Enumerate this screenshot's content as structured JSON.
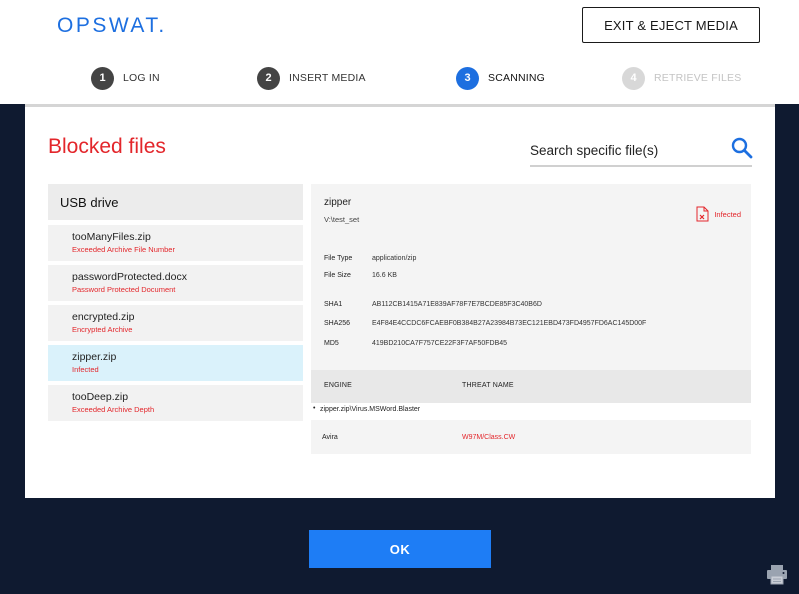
{
  "header": {
    "logo_text": "OPSWAT.",
    "exit_label": "EXIT & EJECT MEDIA"
  },
  "steps": [
    {
      "num": "1",
      "label": "LOG IN",
      "state": "done"
    },
    {
      "num": "2",
      "label": "INSERT MEDIA",
      "state": "done"
    },
    {
      "num": "3",
      "label": "SCANNING",
      "state": "active"
    },
    {
      "num": "4",
      "label": "RETRIEVE FILES",
      "state": "disabled"
    }
  ],
  "main": {
    "title": "Blocked files",
    "search_placeholder": "Search specific file(s)",
    "drive_label": "USB drive",
    "files": [
      {
        "name": "tooManyFiles.zip",
        "status": "Exceeded Archive File Number"
      },
      {
        "name": "passwordProtected.docx",
        "status": "Password Protected Document"
      },
      {
        "name": "encrypted.zip",
        "status": "Encrypted Archive"
      },
      {
        "name": "zipper.zip",
        "status": "Infected"
      },
      {
        "name": "tooDeep.zip",
        "status": "Exceeded Archive Depth"
      }
    ]
  },
  "detail": {
    "name": "zipper",
    "path": "V:\\test_set",
    "status_label": "Infected",
    "file_type_label": "File Type",
    "file_type": "application/zip",
    "file_size_label": "File Size",
    "file_size": "16.6 KB",
    "sha1_label": "SHA1",
    "sha1": "AB112CB1415A71E839AF78F7E7BCDE85F3C40B6D",
    "sha256_label": "SHA256",
    "sha256": "E4F84E4CCDC6FCAEBF0B384B27A23984B73EC121EBD473FD4957FD6AC145D00F",
    "md5_label": "MD5",
    "md5": "419BD210CA7F757CE22F3F7AF50FDB45",
    "engine_header": "ENGINE",
    "threat_header": "THREAT NAME",
    "sub_path": "zipper.zip\\Virus.MSWord.Blaster",
    "engine": "Avira",
    "threat": "W97M/Class.CW"
  },
  "footer": {
    "ok_label": "OK"
  },
  "colors": {
    "brand": "#1d6fe0",
    "danger": "#e3262b",
    "background": "#0f1a30",
    "ok_button": "#1e7df5",
    "selected_row": "#daf2fb"
  }
}
